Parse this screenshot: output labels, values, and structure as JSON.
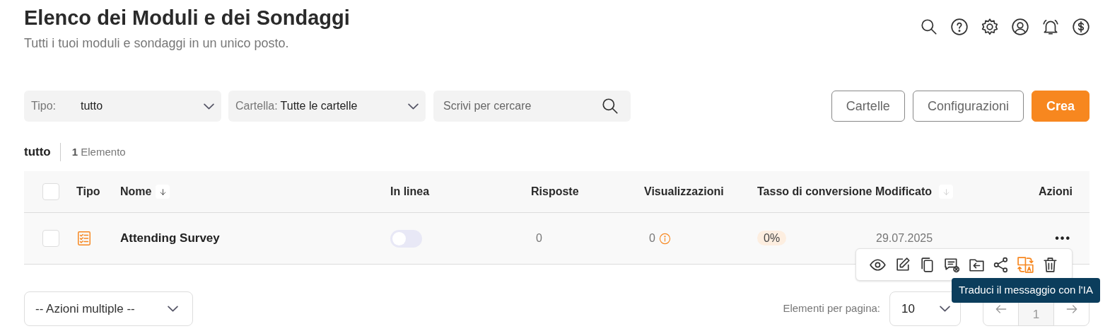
{
  "header": {
    "title": "Elenco dei Moduli e dei Sondaggi",
    "subtitle": "Tutti i tuoi moduli e sondaggi in un unico posto."
  },
  "filters": {
    "type_label": "Tipo:",
    "type_value": "tutto",
    "folder_label": "Cartella:",
    "folder_value": "Tutte le cartelle",
    "search_placeholder": "Scrivi per cercare"
  },
  "buttons": [
    {
      "label": "Cartelle",
      "kind": "outline"
    },
    {
      "label": "Configurazioni",
      "kind": "outline"
    },
    {
      "label": "Crea",
      "kind": "primary"
    }
  ],
  "summary": {
    "filter": "tutto",
    "count": "1",
    "count_label": "Elemento"
  },
  "table": {
    "columns": [
      {
        "label": "Tipo",
        "kind": "plain"
      },
      {
        "label": "Nome",
        "kind": "sorted"
      },
      {
        "label": "In linea",
        "kind": "plain"
      },
      {
        "label": "Risposte",
        "kind": "plain"
      },
      {
        "label": "Visualizzazioni",
        "kind": "plain"
      },
      {
        "label": "Tasso di conversione",
        "kind": "plain"
      },
      {
        "label": "Modificato",
        "kind": "sortable"
      },
      {
        "label": "Azioni",
        "kind": "plain"
      }
    ],
    "rows": [
      {
        "checked": false,
        "name": "Attending Survey",
        "online": false,
        "responses": "0",
        "views": "0",
        "conversion": "0%",
        "modified": "29.07.2025",
        "actions": "•••"
      }
    ]
  },
  "actions_menu": {
    "items": [
      {
        "kind": "view",
        "selected": false
      },
      {
        "kind": "edit",
        "selected": false
      },
      {
        "kind": "copy",
        "selected": false
      },
      {
        "kind": "comments",
        "selected": false
      },
      {
        "kind": "move",
        "selected": false
      },
      {
        "kind": "share",
        "selected": false
      },
      {
        "kind": "translate",
        "selected": true
      },
      {
        "kind": "delete",
        "selected": false
      }
    ],
    "tooltip": "Traduci il messaggio con l'IA"
  },
  "footer": {
    "bulk_select": "-- Azioni multiple --",
    "per_page_label": "Elementi per pagina:",
    "per_page_value": "10",
    "pages": [
      {
        "label": "1",
        "selected": true
      }
    ]
  }
}
